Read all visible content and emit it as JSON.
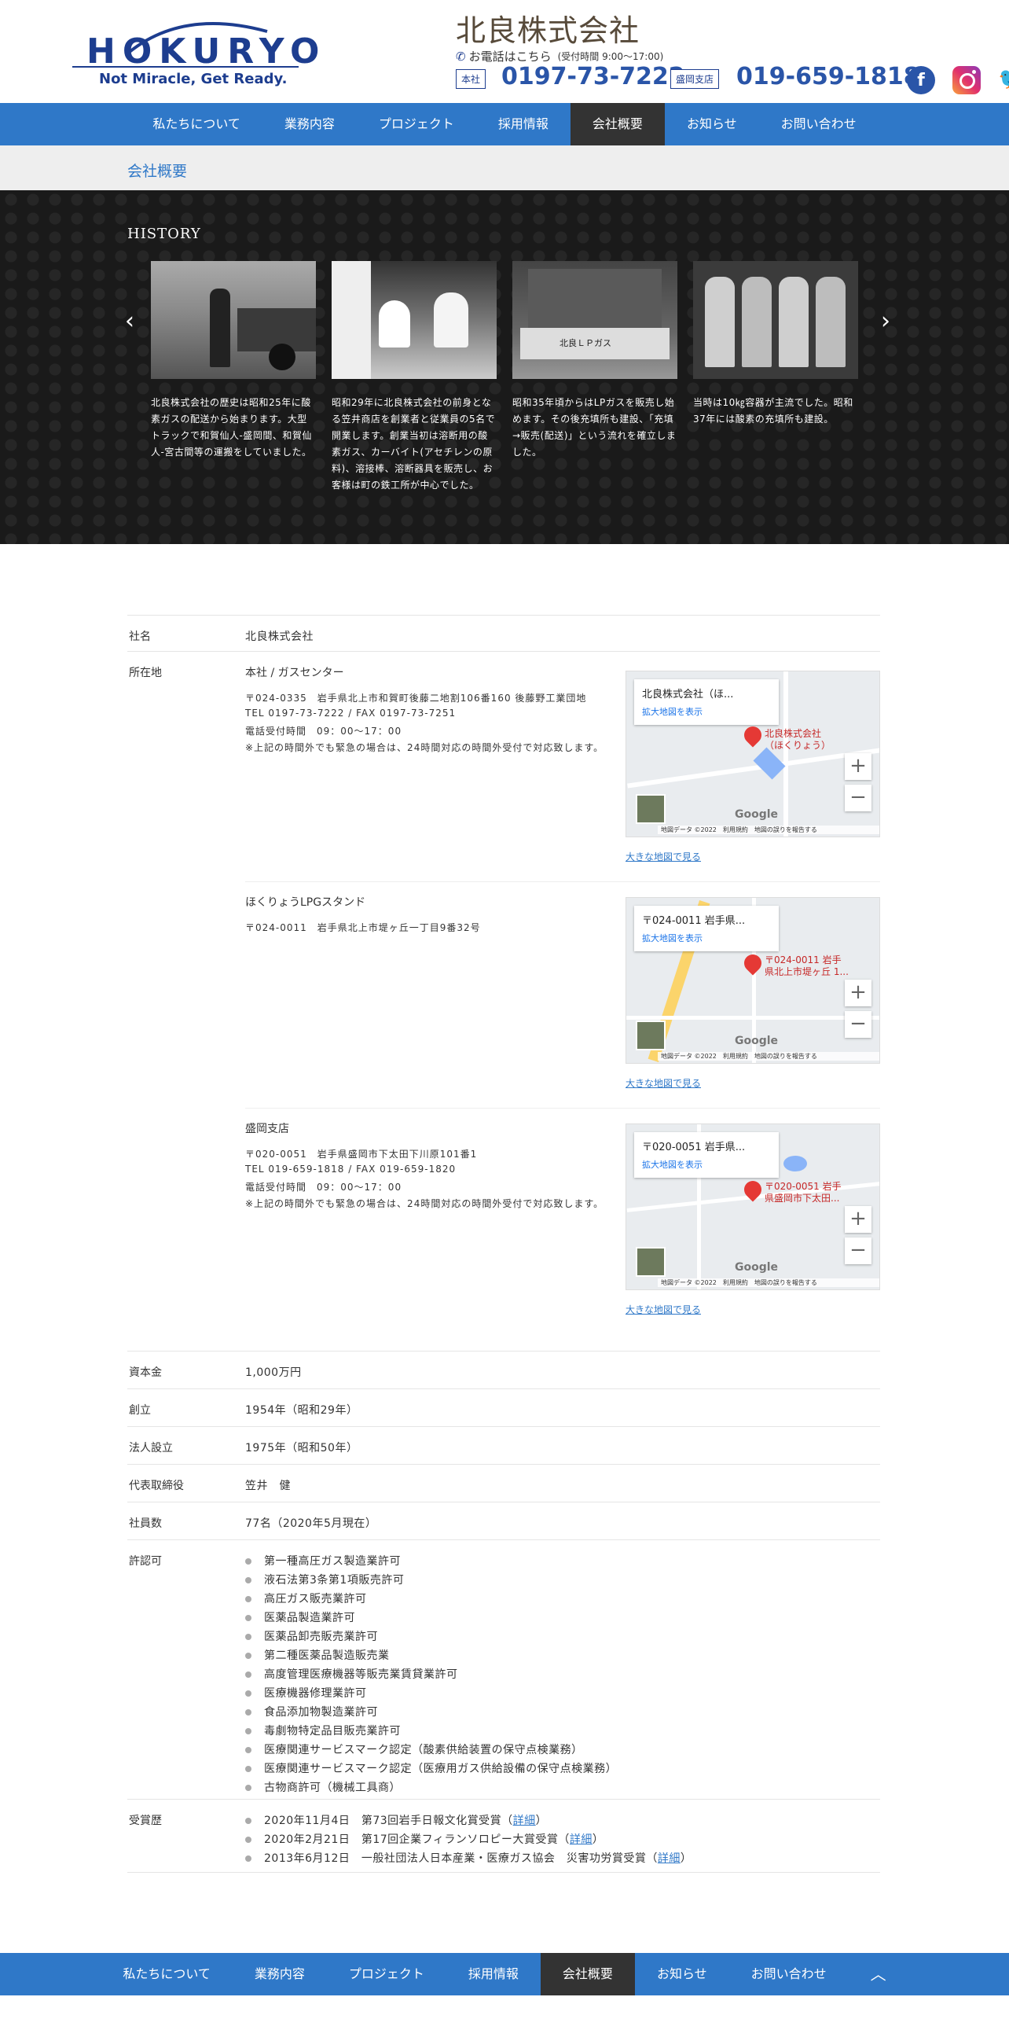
{
  "header": {
    "logo_text": "HOKURYO",
    "logo_tagline": "Not Miracle, Get Ready.",
    "company_name": "北良株式会社",
    "phone_label": "お電話はこちら",
    "phone_hours": "(受付時間 9:00〜17:00)",
    "hq_tag": "本社",
    "hq_phone": "0197-73-7222",
    "branch_tag": "盛岡支店",
    "branch_phone": "019-659-1818",
    "social": [
      "facebook-icon",
      "instagram-icon",
      "twitter-icon"
    ]
  },
  "nav": {
    "items": [
      "私たちについて",
      "業務内容",
      "プロジェクト",
      "採用情報",
      "会社概要",
      "お知らせ",
      "お問い合わせ"
    ],
    "active": "会社概要"
  },
  "subheader": {
    "title": "会社概要"
  },
  "history": {
    "title": "HISTORY",
    "cards": [
      {
        "text": "北良株式会社の歴史は昭和25年に酸素ガスの配送から始まります。大型トラックで和賀仙人-盛岡間、和賀仙人-宮古間等の運搬をしていました。"
      },
      {
        "text": "昭和29年に北良株式会社の前身となる笠井商店を創業者と従業員の5名で開業します。創業当初は溶断用の酸素ガス、カーバイト(アセチレンの原料)、溶接棒、溶断器具を販売し、お客様は町の鉄工所が中心でした。"
      },
      {
        "text": "昭和35年頃からはLPガスを販売し始めます。その後充填所も建設、「充填→販売(配送)」という流れを確立しました。"
      },
      {
        "text": "当時は10㎏容器が主流でした。昭和37年には酸素の充填所も建設。"
      }
    ]
  },
  "info": {
    "company_label": "社名",
    "company_value": "北良株式会社",
    "address_label": "所在地",
    "locations": [
      {
        "title": "本社 / ガスセンター",
        "lines": [
          "〒024-0335　岩手県北上市和賀町後藤二地割106番160 後藤野工業団地",
          "TEL 0197-73-7222 / FAX 0197-73-7251",
          "電話受付時間　09：00〜17：00",
          "※上記の時間外でも緊急の場合は、24時間対応の時間外受付で対応致します。"
        ],
        "map": {
          "card_title": "北良株式会社（ほ...",
          "card_link": "拡大地図を表示",
          "pin_label": [
            "北良株式会社",
            "（ほくりょう）"
          ],
          "footer": "地図データ ©2022　利用規約　地図の誤りを報告する",
          "google": "Google"
        },
        "big_map_link": "大きな地図で見る"
      },
      {
        "title": "ほくりょうLPGスタンド",
        "lines": [
          "〒024-0011　岩手県北上市堤ヶ丘一丁目9番32号"
        ],
        "map": {
          "card_title": "〒024-0011 岩手県...",
          "card_link": "拡大地図を表示",
          "pin_label": [
            "〒024-0011 岩手",
            "県北上市堤ヶ丘 1..."
          ],
          "footer": "地図データ ©2022　利用規約　地図の誤りを報告する",
          "google": "Google"
        },
        "big_map_link": "大きな地図で見る"
      },
      {
        "title": "盛岡支店",
        "lines": [
          "〒020-0051　岩手県盛岡市下太田下川原101番1",
          "TEL 019-659-1818 / FAX 019-659-1820",
          "電話受付時間　09：00〜17：00",
          "※上記の時間外でも緊急の場合は、24時間対応の時間外受付で対応致します。"
        ],
        "map": {
          "card_title": "〒020-0051 岩手県...",
          "card_link": "拡大地図を表示",
          "pin_label": [
            "〒020-0051 岩手",
            "県盛岡市下太田..."
          ],
          "footer": "地図データ ©2022　利用規約　地図の誤りを報告する",
          "google": "Google"
        },
        "big_map_link": "大きな地図で見る"
      }
    ],
    "capital_label": "資本金",
    "capital_value": "1,000万円",
    "founded_label": "創立",
    "founded_value": "1954年（昭和29年）",
    "incorporated_label": "法人設立",
    "incorporated_value": "1975年（昭和50年）",
    "ceo_label": "代表取締役",
    "ceo_value": "笠井　健",
    "employees_label": "社員数",
    "employees_value": "77名（2020年5月現在）",
    "licenses_label": "許認可",
    "licenses": [
      "第一種高圧ガス製造業許可",
      "液石法第3条第1項販売許可",
      "高圧ガス販売業許可",
      "医薬品製造業許可",
      "医薬品卸売販売業許可",
      "第二種医薬品製造販売業",
      "高度管理医療機器等販売業賃貸業許可",
      "医療機器修理業許可",
      "食品添加物製造業許可",
      "毒劇物特定品目販売業許可",
      "医療関連サービスマーク認定（酸素供給装置の保守点検業務）",
      "医療関連サービスマーク認定（医療用ガス供給設備の保守点検業務）",
      "古物商許可（機械工具商）"
    ],
    "awards_label": "受賞歴",
    "awards": [
      {
        "text": "2020年11月4日　第73回岩手日報文化賞受賞（",
        "link": "詳細",
        "end": "）"
      },
      {
        "text": "2020年2月21日　第17回企業フィランソロピー大賞受賞（",
        "link": "詳細",
        "end": "）"
      },
      {
        "text": "2013年6月12日　一般社団法人日本産業・医療ガス協会　災害功労賞受賞（",
        "link": "詳細",
        "end": "）"
      }
    ]
  },
  "colors": {
    "primary": "#2f78c8",
    "brand_navy": "#1d3d8f",
    "active_nav": "#333333",
    "history_bg": "#1a1a1a"
  }
}
